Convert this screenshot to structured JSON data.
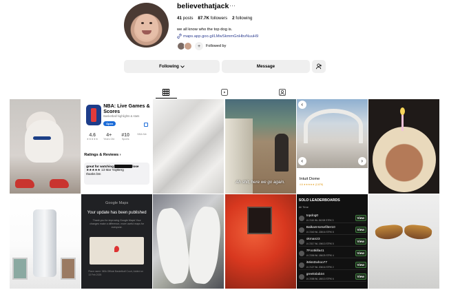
{
  "profile": {
    "username": "believethatjack",
    "more_icon": "···",
    "posts_count": "41",
    "posts_label": "posts",
    "followers_count": "87.7K",
    "followers_label": "followers",
    "following_count": "2",
    "following_label": "following",
    "bio": "we all know who the top dog is.",
    "link": "maps.app.goo.gl/LMwSkmmGnHbvNuuH9",
    "followed_by_label": "Followed by",
    "plus_icon": "+"
  },
  "actions": {
    "following_label": "Following",
    "message_label": "Message"
  },
  "tabs": [
    "posts-grid-icon",
    "reels-icon",
    "tagged-icon"
  ],
  "posts": {
    "app": {
      "title": "NBA: Live Games & Scores",
      "subtitle": "Basketball highlights & stats",
      "open_label": "Open",
      "meta": [
        {
          "top": "4.6",
          "bottom": "★★★★★"
        },
        {
          "top": "4+",
          "bottom": "Years Old"
        },
        {
          "top": "#10",
          "bottom": "Sports"
        },
        {
          "top": "",
          "bottom": "NBA Me"
        }
      ],
      "ratings_title": "Ratings & Reviews ›",
      "review_title": "great for watching",
      "review_end": "lose",
      "review_meta": "★★★★★  13 Mar  YayBerg",
      "review_body": "thanks btn"
    },
    "game_subtitle": "Ah shit, here we go again.",
    "intuit": {
      "name": "Intuit Dome",
      "rating": "4.6 ★★★★★ (2,878)"
    },
    "maps": {
      "header": "Google Maps",
      "title": "Your update has been published",
      "body": "Thank you for improving Google Maps! Your changes make a difference, more useful maps for everyone.",
      "footer": "Place name: NBA Official Basketball Court, Added on 13 Feb 2025"
    },
    "leaderboard": {
      "title": "SOLO LEADERBOARDS",
      "filter": "All Time",
      "view_label": "View",
      "rows": [
        {
          "name": "topdog0",
          "sub": "LV 2110  WL 262/28  STRK 3"
        },
        {
          "name": "BalkanHorsefilter10",
          "sub": "LV 2340  WL 228/16  STRK 8"
        },
        {
          "name": "okman23",
          "sub": "LV 2317  WL 196/13  STRK 5"
        },
        {
          "name": "7Footkilla41",
          "sub": "LV 2306  WL 186/25  STRK 4"
        },
        {
          "name": "iMissDahoo77",
          "sub": "LV 2127  WL 206/16  STRK 2"
        },
        {
          "name": "greekslab34",
          "sub": "LV 2058  WL 180/13  STRK 6"
        }
      ]
    }
  }
}
